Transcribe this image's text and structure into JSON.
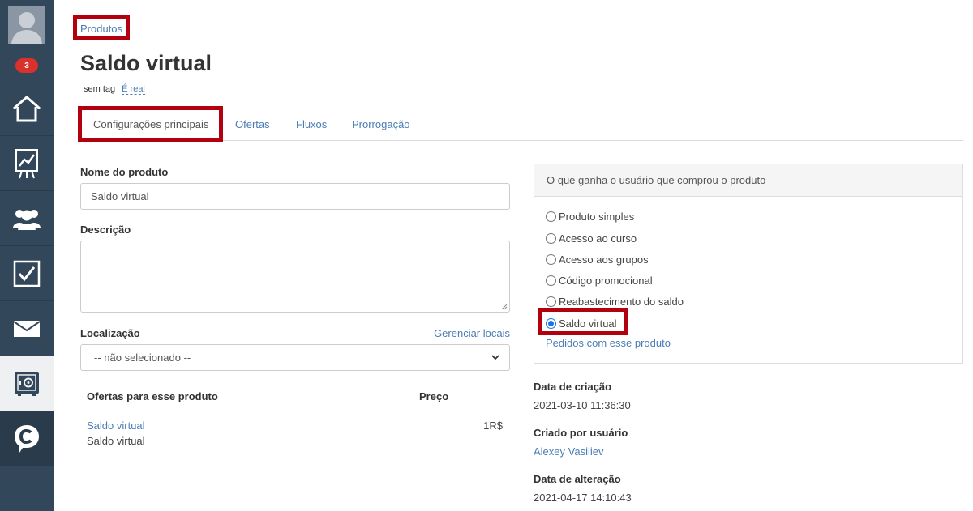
{
  "sidebar": {
    "badge_count": "3",
    "items": [
      {
        "icon": "home-icon"
      },
      {
        "icon": "chart-icon"
      },
      {
        "icon": "users-icon"
      },
      {
        "icon": "tasks-icon"
      },
      {
        "icon": "mail-icon"
      },
      {
        "icon": "safe-icon"
      },
      {
        "icon": "chat-icon"
      }
    ]
  },
  "breadcrumb": "Produtos",
  "page_title": "Saldo virtual",
  "tags": {
    "sem_tag": "sem tag",
    "real": "É real"
  },
  "tabs": [
    {
      "label": "Configurações principais"
    },
    {
      "label": "Ofertas"
    },
    {
      "label": "Fluxos"
    },
    {
      "label": "Prorrogação"
    }
  ],
  "form": {
    "name_label": "Nome do produto",
    "name_value": "Saldo virtual",
    "description_label": "Descrição",
    "description_value": "",
    "location_label": "Localização",
    "manage_locations": "Gerenciar locais",
    "location_selected": "-- não selecionado --"
  },
  "offers": {
    "header_name": "Ofertas para esse produto",
    "header_price": "Preço",
    "rows": [
      {
        "link": "Saldo virtual",
        "subtitle": "Saldo virtual",
        "price": "1R$"
      }
    ]
  },
  "right_panel": {
    "title": "O que ganha o usuário que comprou o produto",
    "options": [
      {
        "label": "Produto simples",
        "checked": false
      },
      {
        "label": "Acesso ao curso",
        "checked": false
      },
      {
        "label": "Acesso aos grupos",
        "checked": false
      },
      {
        "label": "Código promocional",
        "checked": false
      },
      {
        "label": "Reabastecimento do saldo",
        "checked": false
      },
      {
        "label": "Saldo virtual",
        "checked": true
      }
    ],
    "orders_link": "Pedidos com esse produto"
  },
  "meta": {
    "created_label": "Data de criação",
    "created_value": "2021-03-10 11:36:30",
    "creator_label": "Criado por usuário",
    "creator_value": "Alexey Vasiliev",
    "modified_label": "Data de alteração",
    "modified_value": "2021-04-17 14:10:43"
  },
  "colors": {
    "sidebar": "#33475b",
    "link": "#4a7db5",
    "highlight": "#b3000f",
    "badge": "#d9312b"
  }
}
